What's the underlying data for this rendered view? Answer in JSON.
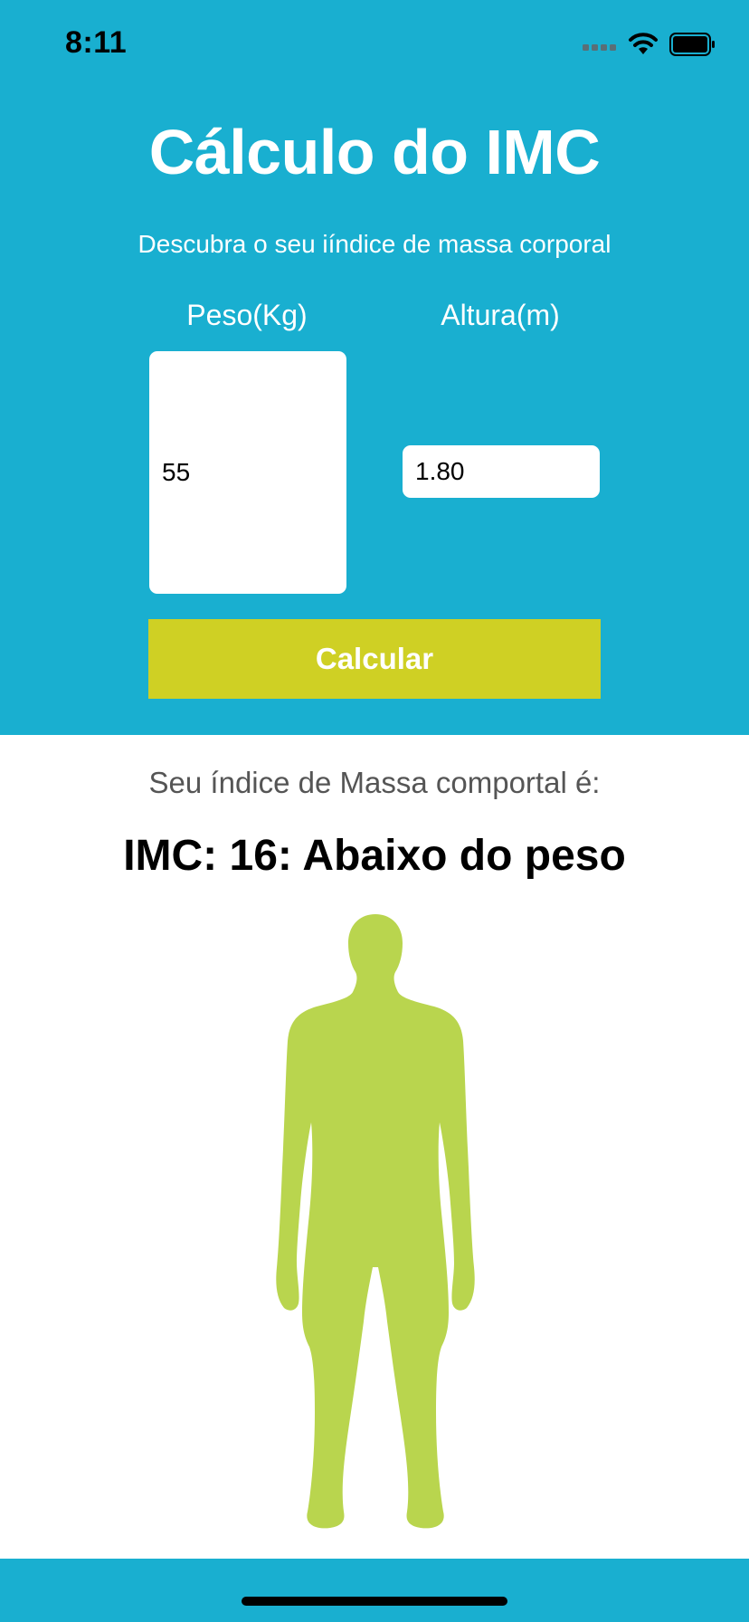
{
  "status_bar": {
    "time": "8:11"
  },
  "header": {
    "title": "Cálculo do IMC",
    "subtitle": "Descubra o seu iíndice de massa corporal"
  },
  "form": {
    "weight_label": "Peso(Kg)",
    "height_label": "Altura(m)",
    "weight_value": "55",
    "height_value": "1.80",
    "calculate_label": "Calcular"
  },
  "result": {
    "label": "Seu índice de Massa comportal é:",
    "value": "IMC: 16:  Abaixo do peso"
  },
  "colors": {
    "primary": "#19afd0",
    "button": "#cfd024",
    "figure": "#b9d54e"
  },
  "icons": [
    "cellular-signal-icon",
    "wifi-icon",
    "battery-icon",
    "body-silhouette-icon"
  ]
}
